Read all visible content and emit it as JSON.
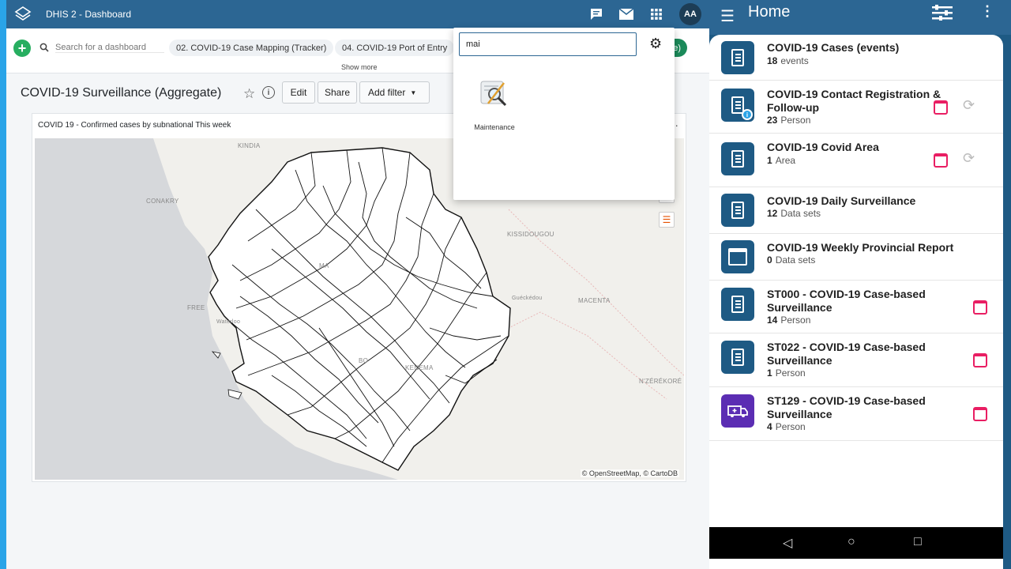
{
  "dhis": {
    "app_title": "DHIS 2 - Dashboard",
    "avatar": "AA",
    "search_placeholder": "Search for a dashboard",
    "chips": [
      "02. COVID-19 Case Mapping (Tracker)",
      "04. COVID-19 Port of Entry"
    ],
    "chip_active_tail": "e)",
    "show_more": "Show more",
    "dashboard_title": "COVID-19 Surveillance (Aggregate)",
    "buttons": {
      "edit": "Edit",
      "share": "Share",
      "add_filter": "Add filter"
    },
    "card": {
      "title": "COVID 19 - Confirmed cases by subnational This week",
      "map_labels": [
        "KINDIA",
        "CONAKRY",
        "KISSIDOUGOU",
        "Guéckédou",
        "MACENTA",
        "N'ZÉRÉKORÉ",
        "FREE",
        "Waterloo",
        "MA",
        "KENEMA",
        "BO"
      ],
      "attribution": "© OpenStreetMap, © CartoDB"
    },
    "app_search": {
      "query": "mai",
      "result": "Maintenance"
    }
  },
  "android": {
    "title": "Home",
    "programs": [
      {
        "name": "COVID-19 Cases (events)",
        "count": "18",
        "unit": "events",
        "icon": "doc-icon",
        "badge": false,
        "cal": false,
        "sync": false
      },
      {
        "name": "COVID-19 Contact Registration & Follow-up",
        "count": "23",
        "unit": "Person",
        "icon": "doc-icon",
        "badge": true,
        "cal": true,
        "sync": true
      },
      {
        "name": "COVID-19 Covid Area",
        "count": "1",
        "unit": "Area",
        "icon": "doc-icon",
        "badge": false,
        "cal": true,
        "sync": true
      },
      {
        "name": "COVID-19 Daily Surveillance",
        "count": "12",
        "unit": "Data sets",
        "icon": "doc-icon",
        "badge": false,
        "cal": false,
        "sync": false
      },
      {
        "name": "COVID-19 Weekly Provincial Report",
        "count": "0",
        "unit": "Data sets",
        "icon": "calendar-icon",
        "badge": false,
        "cal": false,
        "sync": false
      },
      {
        "name": "ST000 - COVID-19 Case-based Surveillance",
        "count": "14",
        "unit": "Person",
        "icon": "doc-icon",
        "badge": false,
        "cal": true,
        "sync": false
      },
      {
        "name": "ST022 - COVID-19 Case-based Surveillance",
        "count": "1",
        "unit": "Person",
        "icon": "doc-icon",
        "badge": false,
        "cal": true,
        "sync": false
      },
      {
        "name": "ST129 - COVID-19 Case-based Surveillance",
        "count": "4",
        "unit": "Person",
        "icon": "ambulance-icon",
        "badge": false,
        "cal": true,
        "sync": false
      }
    ]
  }
}
